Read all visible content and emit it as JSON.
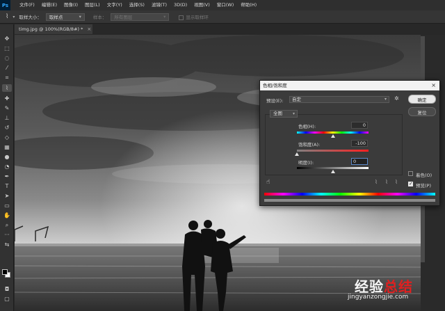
{
  "app": {
    "logo": "Ps"
  },
  "menubar": {
    "items": [
      "文件(F)",
      "编辑(E)",
      "图像(I)",
      "图层(L)",
      "文字(Y)",
      "选择(S)",
      "滤镜(T)",
      "3D(D)",
      "视图(V)",
      "窗口(W)",
      "帮助(H)"
    ]
  },
  "options_bar": {
    "tool_icon": "eyedropper-icon",
    "sample_size_label": "取样大小：",
    "sample_size_value": "取样点",
    "sample_label": "样本：",
    "sample_value": "所有图层",
    "show_ring_label": "显示取样环"
  },
  "document": {
    "tab_title": "timg.jpg @ 100%(RGB/8#) *",
    "close": "×"
  },
  "dialog": {
    "title": "色相/饱和度",
    "close": "×",
    "preset_label": "预设(E):",
    "preset_value": "自定",
    "ok_label": "确定",
    "reset_label": "复位",
    "channel_value": "全图",
    "hue_label": "色相(H):",
    "hue_value": "0",
    "saturation_label": "饱和度(A):",
    "saturation_value": "-100",
    "lightness_label": "明度(I):",
    "lightness_value": "0",
    "colorize_label": "着色(O)",
    "colorize_checked": false,
    "preview_label": "预览(P)",
    "preview_checked": true,
    "hue_slider_level": 0.5,
    "saturation_slider_level": 0.0,
    "lightness_slider_level": 0.5
  },
  "watermark": {
    "text_1": "经验",
    "text_2": "总结",
    "url": "jingyanzongjie.com"
  },
  "colors": {
    "accent": "#31a8ff",
    "foreground_color": "#000000",
    "background_color": "#ffffff"
  }
}
